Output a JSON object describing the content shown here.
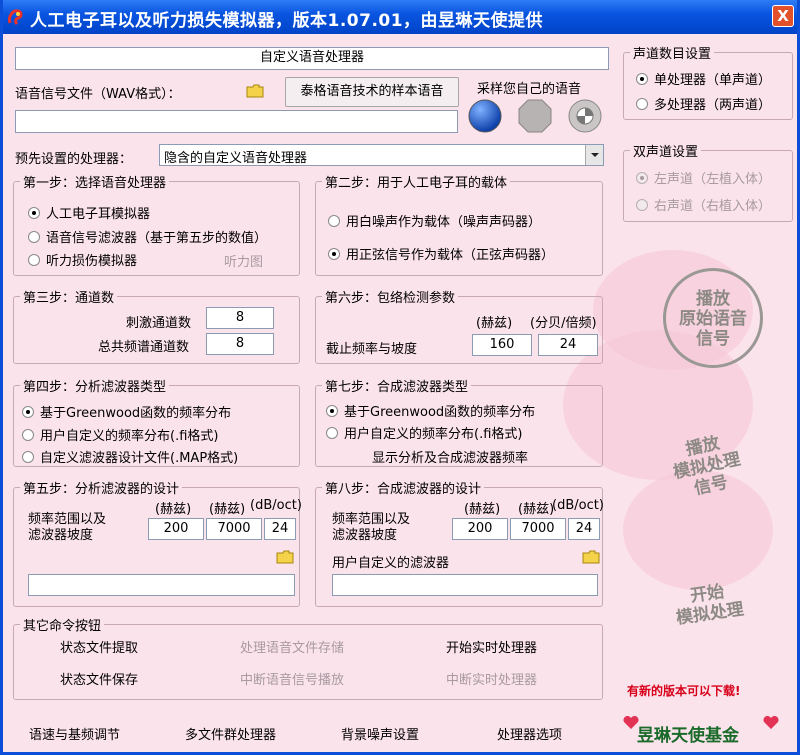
{
  "window": {
    "title": "人工电子耳以及听力损失模拟器，版本1.07.01，由昱琳天使提供",
    "close_label": "X"
  },
  "header": {
    "processor_name": "自定义语音处理器",
    "wav_label": "语音信号文件（WAV格式）：",
    "sample_button": "泰格语音技术的样本语音",
    "sample_own_label": "采样您自己的语音",
    "wav_path": ""
  },
  "preset": {
    "label": "预先设置的处理器：",
    "selected": "隐含的自定义语音处理器"
  },
  "channel_count": {
    "title": "声道数目设置",
    "options": [
      "单处理器（单声道）",
      "多处理器（两声道）"
    ],
    "selected_index": 0
  },
  "binaural": {
    "title": "双声道设置",
    "options": [
      "左声道（左植入体）",
      "右声道（右植入体）"
    ],
    "selected_index": 0
  },
  "step1": {
    "title": "第一步：选择语音处理器",
    "options": [
      "人工电子耳模拟器",
      "语音信号滤波器（基于第五步的数值）",
      "听力损伤模拟器"
    ],
    "selected_index": 0,
    "audiogram": "听力图"
  },
  "step2": {
    "title": "第二步：用于人工电子耳的载体",
    "options": [
      "用白噪声作为载体（噪声声码器）",
      "用正弦信号作为载体（正弦声码器）"
    ],
    "selected_index": 1
  },
  "step3": {
    "title": "第三步：通道数",
    "stim_label": "刺激通道数",
    "stim_value": "8",
    "total_label": "总共频谱通道数",
    "total_value": "8"
  },
  "step6": {
    "title": "第六步：包络检测参数",
    "unit_hz": "(赫兹)",
    "unit_db": "(分贝/倍频)",
    "label": "截止频率与坡度",
    "cutoff": "160",
    "slope": "24"
  },
  "step4": {
    "title": "第四步：分析滤波器类型",
    "options": [
      "基于Greenwood函数的频率分布",
      "用户自定义的频率分布(.fi格式)",
      "自定义滤波器设计文件(.MAP格式)"
    ],
    "selected_index": 0
  },
  "step7": {
    "title": "第七步：合成滤波器类型",
    "options": [
      "基于Greenwood函数的频率分布",
      "用户自定义的频率分布(.fi格式)"
    ],
    "selected_index": 0,
    "show_link": "显示分析及合成滤波器频率"
  },
  "step5": {
    "title": "第五步：分析滤波器的设计",
    "h1": "(赫兹)",
    "h2": "(赫兹)",
    "h3": "(dB/oct)",
    "label": "频率范围以及\n滤波器坡度",
    "low": "200",
    "high": "7000",
    "slope": "24",
    "path": ""
  },
  "step8": {
    "title": "第八步：合成滤波器的设计",
    "h1": "(赫兹)",
    "h2": "(赫兹)",
    "h3": "(dB/oct)",
    "label": "频率范围以及\n滤波器坡度",
    "low": "200",
    "high": "7000",
    "slope": "24",
    "custom_label": "用户自定义的滤波器",
    "path": ""
  },
  "other": {
    "title": "其它命令按钮",
    "load_state": "状态文件提取",
    "save_speech": "处理语音文件存储",
    "start_rt": "开始实时处理器",
    "save_state": "状态文件保存",
    "stop_play": "中断语音信号播放",
    "stop_rt": "中断实时处理器"
  },
  "bottom": {
    "rate_pitch": "语速与基频调节",
    "multi_file": "多文件群处理器",
    "bg_noise": "背景噪声设置",
    "options": "处理器选项"
  },
  "side": {
    "play_original": "播放\n原始语音\n信号",
    "play_sim": "播放\n模拟处理\n信号",
    "start_sim": "开始\n模拟处理",
    "new_version": "有新的版本可以下载!",
    "foundation": "昱琳天使基金"
  },
  "colors": {
    "titlebar": "#0a55e0",
    "background": "#fbe3ec",
    "red_text": "#d8001a",
    "foundation_text": "#1a6b2a"
  }
}
